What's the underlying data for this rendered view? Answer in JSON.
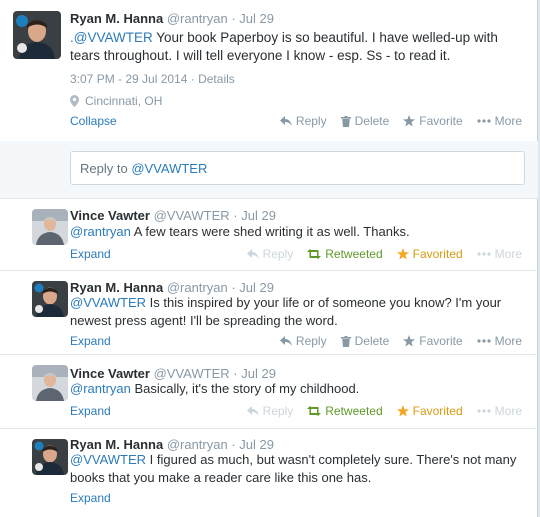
{
  "main_tweet": {
    "name": "Ryan M. Hanna",
    "handle": "@rantryan",
    "dot": "·",
    "date": "Jul 29",
    "mention": ".@VVAWTER",
    "text": " Your book Paperboy is so beautiful. I have welled-up with tears throughout. I will tell everyone I know - esp. Ss - to read it.",
    "timestamp": "3:07 PM - 29 Jul 2014",
    "dot2": "·",
    "details": "Details",
    "location": "Cincinnati, OH",
    "collapse": "Collapse",
    "actions": {
      "reply": "Reply",
      "delete": "Delete",
      "favorite": "Favorite",
      "more": "More"
    }
  },
  "reply_box": {
    "prefix": "Reply to ",
    "mention": "@VVAWTER"
  },
  "thread": [
    {
      "name": "Vince Vawter",
      "handle": "@VVAWTER",
      "date": "Jul 29",
      "mention": "@rantryan",
      "text": " A few tears were shed writing it as well. Thanks.",
      "expand": "Expand",
      "actions": {
        "reply": "Reply",
        "retweet": "Retweeted",
        "favorite": "Favorited",
        "more": "More"
      }
    },
    {
      "name": "Ryan M. Hanna",
      "handle": "@rantryan",
      "date": "Jul 29",
      "mention": "@VVAWTER",
      "text": " Is this inspired by your life or of someone you know? I'm your newest press agent! I'll be spreading the word.",
      "expand": "Expand",
      "actions": {
        "reply": "Reply",
        "delete": "Delete",
        "favorite": "Favorite",
        "more": "More"
      }
    },
    {
      "name": "Vince Vawter",
      "handle": "@VVAWTER",
      "date": "Jul 29",
      "mention": "@rantryan",
      "text": " Basically, it's the story of my childhood.",
      "expand": "Expand",
      "actions": {
        "reply": "Reply",
        "retweet": "Retweeted",
        "favorite": "Favorited",
        "more": "More"
      }
    },
    {
      "name": "Ryan M. Hanna",
      "handle": "@rantryan",
      "date": "Jul 29",
      "mention": "@VVAWTER",
      "text": " I figured as much, but wasn't completely sure. There's not many books that you make a reader care like this one has.",
      "expand": "Expand"
    }
  ],
  "colors": {
    "link": "#2b7bb9",
    "retweeted": "#609928",
    "favorited": "#d99a13",
    "muted": "#8899a6"
  }
}
